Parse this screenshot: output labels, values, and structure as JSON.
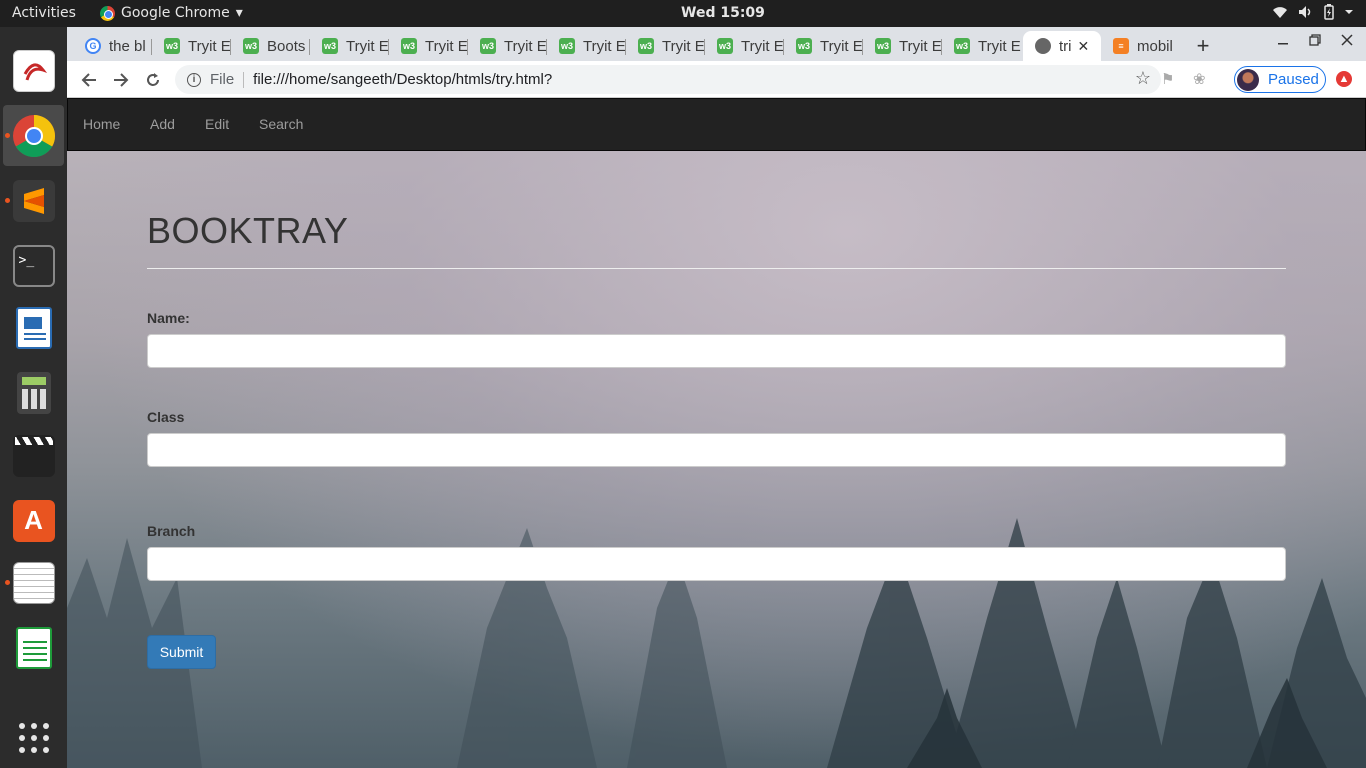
{
  "topbar": {
    "activities": "Activities",
    "app_name": "Google Chrome",
    "app_caret": "▾",
    "clock": "Wed 15:09"
  },
  "dock": {
    "items": [
      {
        "name": "evince-icon",
        "color": "#ffffff"
      },
      {
        "name": "chrome-icon",
        "color": "#4285f4"
      },
      {
        "name": "sublime-text-icon",
        "color": "#ff9800"
      },
      {
        "name": "terminal-icon",
        "color": "#2b2b2b"
      },
      {
        "name": "libreoffice-writer-icon",
        "color": "#2a6cb3"
      },
      {
        "name": "calculator-icon",
        "color": "#3c3c3c"
      },
      {
        "name": "video-editor-icon",
        "color": "#1e1e1e"
      },
      {
        "name": "software-center-icon",
        "color": "#e95420"
      },
      {
        "name": "text-editor-icon",
        "color": "#f5f5f5"
      },
      {
        "name": "libreoffice-calc-icon",
        "color": "#1e9b3a"
      }
    ]
  },
  "browser": {
    "tabs": [
      {
        "label": "the bl",
        "icon": "google-icon"
      },
      {
        "label": "Tryit E",
        "icon": "w3schools-icon"
      },
      {
        "label": "Boots",
        "icon": "w3schools-icon"
      },
      {
        "label": "Tryit E",
        "icon": "w3schools-icon"
      },
      {
        "label": "Tryit E",
        "icon": "w3schools-icon"
      },
      {
        "label": "Tryit E",
        "icon": "w3schools-icon"
      },
      {
        "label": "Tryit E",
        "icon": "w3schools-icon"
      },
      {
        "label": "Tryit E",
        "icon": "w3schools-icon"
      },
      {
        "label": "Tryit E",
        "icon": "w3schools-icon"
      },
      {
        "label": "Tryit E",
        "icon": "w3schools-icon"
      },
      {
        "label": "Tryit E",
        "icon": "w3schools-icon"
      },
      {
        "label": "Tryit E",
        "icon": "w3schools-icon"
      },
      {
        "label": "tri",
        "icon": "globe-icon"
      },
      {
        "label": "mobil",
        "icon": "stackoverflow-icon"
      }
    ],
    "close_glyph": "✕",
    "new_tab_glyph": "+",
    "address": {
      "scheme": "File",
      "url": "file:///home/sangeeth/Desktop/htmls/try.html?"
    },
    "profile_label": "Paused"
  },
  "page": {
    "nav": [
      "Home",
      "Add",
      "Edit",
      "Search"
    ],
    "title": "BOOKTRAY",
    "fields": [
      {
        "label": "Name:",
        "value": ""
      },
      {
        "label": "Class",
        "value": ""
      },
      {
        "label": "Branch",
        "value": ""
      }
    ],
    "submit_label": "Submit"
  },
  "colors": {
    "navbar": "#222222",
    "submit": "#337ab7",
    "accent": "#e95420"
  }
}
